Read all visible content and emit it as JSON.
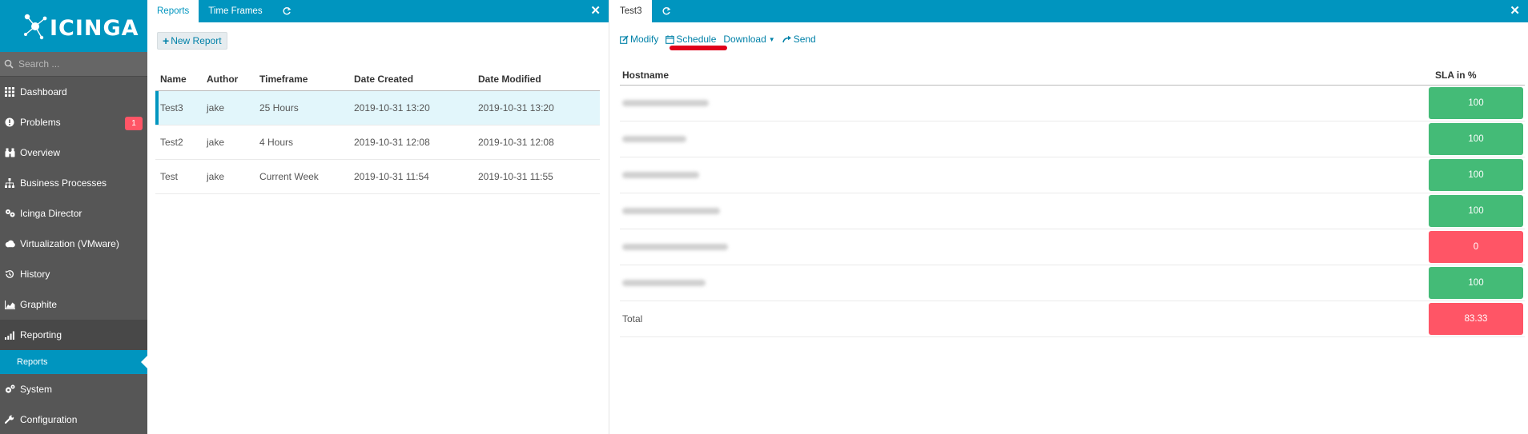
{
  "app": {
    "logo_text": "ICINGA"
  },
  "search": {
    "placeholder": "Search ..."
  },
  "sidebar": {
    "items": [
      {
        "label": "Dashboard",
        "icon": "dashboard-icon"
      },
      {
        "label": "Problems",
        "icon": "problems-icon",
        "badge": "1"
      },
      {
        "label": "Overview",
        "icon": "binoculars-icon"
      },
      {
        "label": "Business Processes",
        "icon": "sitemap-icon"
      },
      {
        "label": "Icinga Director",
        "icon": "director-icon"
      },
      {
        "label": "Virtualization (VMware)",
        "icon": "cloud-icon"
      },
      {
        "label": "History",
        "icon": "history-icon"
      },
      {
        "label": "Graphite",
        "icon": "chart-icon"
      },
      {
        "label": "Reporting",
        "icon": "bar-chart-icon"
      },
      {
        "label": "System",
        "icon": "cogs-icon"
      },
      {
        "label": "Configuration",
        "icon": "wrench-icon"
      }
    ],
    "sub_item": {
      "label": "Reports"
    }
  },
  "left_pane": {
    "tabs": [
      "Reports",
      "Time Frames"
    ],
    "new_report_label": "New Report",
    "table": {
      "headers": [
        "Name",
        "Author",
        "Timeframe",
        "Date Created",
        "Date Modified"
      ],
      "rows": [
        [
          "Test3",
          "jake",
          "25 Hours",
          "2019-10-31 13:20",
          "2019-10-31 13:20"
        ],
        [
          "Test2",
          "jake",
          "4 Hours",
          "2019-10-31 12:08",
          "2019-10-31 12:08"
        ],
        [
          "Test",
          "jake",
          "Current Week",
          "2019-10-31 11:54",
          "2019-10-31 11:55"
        ]
      ]
    }
  },
  "right_pane": {
    "tab": "Test3",
    "actions": {
      "modify": "Modify",
      "schedule": "Schedule",
      "download": "Download",
      "send": "Send"
    },
    "table": {
      "headers": [
        "Hostname",
        "SLA in %"
      ],
      "rows": [
        {
          "sla": "100",
          "status": "ok"
        },
        {
          "sla": "100",
          "status": "ok"
        },
        {
          "sla": "100",
          "status": "ok"
        },
        {
          "sla": "100",
          "status": "ok"
        },
        {
          "sla": "0",
          "status": "critical"
        },
        {
          "sla": "100",
          "status": "ok"
        }
      ],
      "total_label": "Total",
      "total_value": "83.33",
      "total_status": "critical"
    }
  },
  "colors": {
    "brand": "#0095bf",
    "ok": "#44bb77",
    "critical": "#ff5566",
    "annotation": "#e0001a"
  }
}
